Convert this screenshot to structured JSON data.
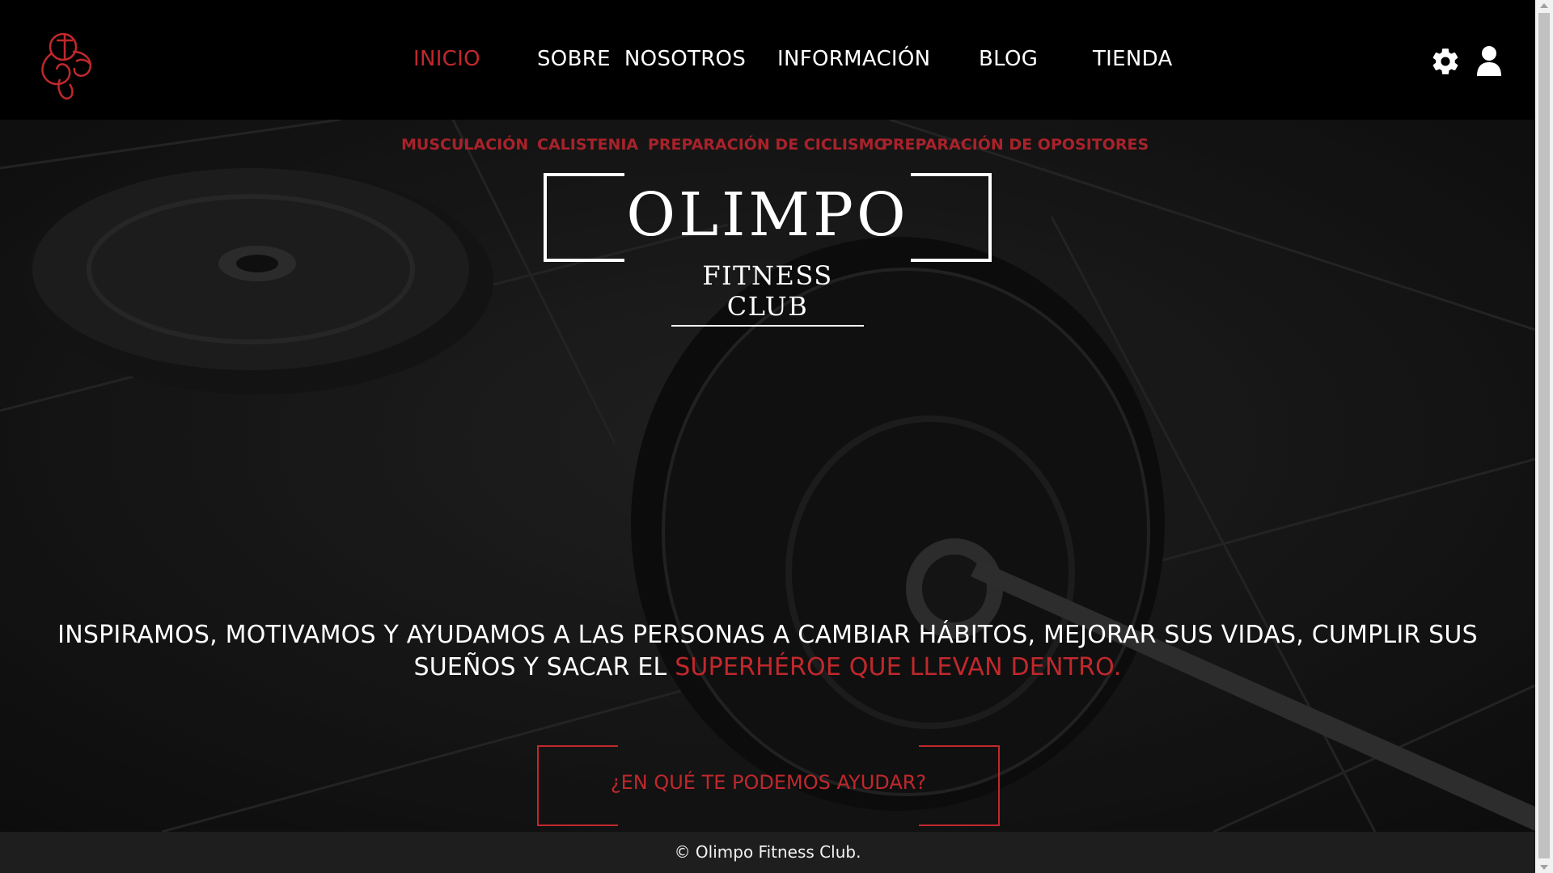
{
  "nav": {
    "items": [
      {
        "label": "INICIO",
        "active": true
      },
      {
        "label": "SOBRE  NOSOTROS",
        "active": false
      },
      {
        "label": "INFORMACIÓN",
        "active": false
      },
      {
        "label": "BLOG",
        "active": false
      },
      {
        "label": "TIENDA",
        "active": false
      }
    ],
    "icons": [
      "gear-icon",
      "user-icon"
    ],
    "logo": "olimpo-logo"
  },
  "subnav": {
    "items": [
      "MUSCULACIÓN",
      "CALISTENIA",
      "PREPARACIÓN DE CICLISMO",
      "PREPARACIÓN DE OPOSITORES"
    ]
  },
  "brand": {
    "title": "OLIMPO",
    "subtitle": "FITNESS CLUB"
  },
  "tagline": {
    "main": "INSPIRAMOS, MOTIVAMOS Y AYUDAMOS A LAS PERSONAS A CAMBIAR HÁBITOS, MEJORAR SUS VIDAS, CUMPLIR SUS SUEÑOS Y SACAR EL ",
    "highlight": "SUPERHÉROE QUE LLEVAN DENTRO."
  },
  "cta": {
    "label": "¿EN QUÉ TE PODEMOS AYUDAR?"
  },
  "footer": {
    "text": "© Olimpo Fitness Club."
  },
  "colors": {
    "accent": "#c0282c",
    "subnav_accent": "#a8222a",
    "navbar_bg": "#000000",
    "footer_bg": "#1e1e1e"
  }
}
